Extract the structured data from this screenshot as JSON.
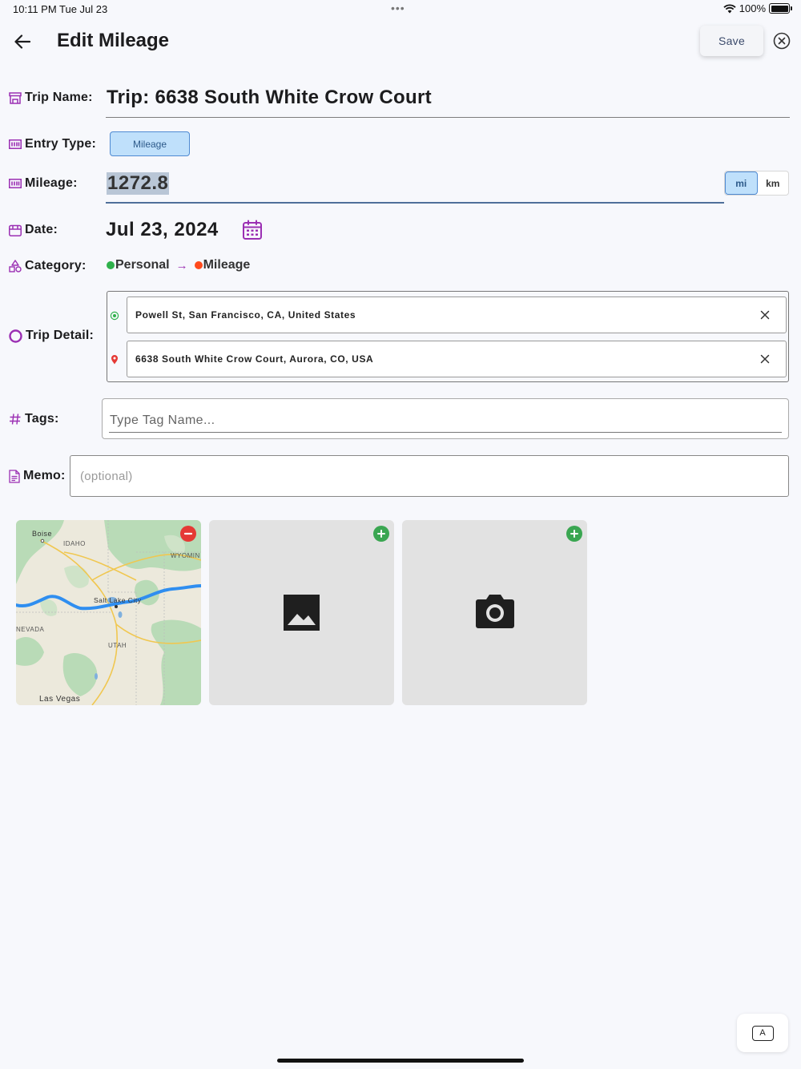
{
  "status_bar": {
    "time": "10:11 PM",
    "date": "Tue Jul 23",
    "dots": "•••",
    "battery": "100%"
  },
  "header": {
    "title": "Edit Mileage",
    "save_label": "Save"
  },
  "form": {
    "trip_name_label": "Trip Name:",
    "trip_name_value": "Trip: 6638 South White Crow Court",
    "entry_type_label": "Entry Type:",
    "entry_type_value": "Mileage",
    "mileage_label": "Mileage:",
    "mileage_value": "1272.8",
    "units": [
      "mi",
      "km"
    ],
    "selected_unit": "mi",
    "date_label": "Date:",
    "date_value": "Jul 23, 2024",
    "category_label": "Category:",
    "category_parent": "Personal",
    "category_child": "Mileage",
    "category_arrow": "→",
    "trip_detail_label": "Trip Detail:",
    "origin": "Powell St, San Francisco, CA, United States",
    "destination": "6638 South White Crow Court, Aurora, CO, USA",
    "tags_label": "Tags:",
    "tags_placeholder": "Type Tag Name...",
    "memo_label": "Memo:",
    "memo_placeholder": "(optional)"
  },
  "map": {
    "labels": [
      "Boise",
      "IDAHO",
      "WYOMIN",
      "Salt Lake City",
      "NEVADA",
      "UTAH",
      "Las Vegas"
    ]
  },
  "keyboard_button": "A",
  "colors": {
    "accent": "#9b2fb3",
    "selected_fill": "#bfe0fb",
    "selected_border": "#4f8ad2",
    "personal_dot": "#2fb14b",
    "mileage_dot": "#ff4a1c",
    "remove": "#e53935",
    "add": "#3aa651"
  }
}
